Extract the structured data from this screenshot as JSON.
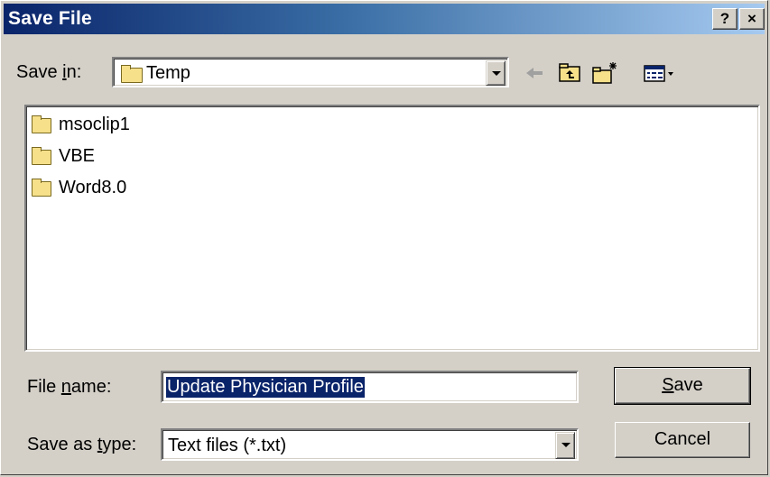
{
  "window": {
    "title": "Save File",
    "help_label": "?",
    "close_label": "×"
  },
  "save_in": {
    "label": "Save in:",
    "value": "Temp"
  },
  "toolbar": {
    "icons": [
      "back-arrow-icon",
      "up-one-level-icon",
      "new-folder-icon",
      "view-menu-icon"
    ]
  },
  "files": [
    {
      "name": "msoclip1",
      "icon": "folder-icon"
    },
    {
      "name": "VBE",
      "icon": "folder-icon"
    },
    {
      "name": "Word8.0",
      "icon": "folder-icon"
    }
  ],
  "file_name": {
    "label": "File name:",
    "value": "Update Physician Profile"
  },
  "save_as_type": {
    "label": "Save as type:",
    "value": "Text files (*.txt)"
  },
  "buttons": {
    "save": "Save",
    "cancel": "Cancel"
  },
  "colors": {
    "titlebar_start": "#0a246a",
    "titlebar_end": "#a6caf0",
    "face": "#d4d0c8",
    "selection": "#0a246a"
  }
}
